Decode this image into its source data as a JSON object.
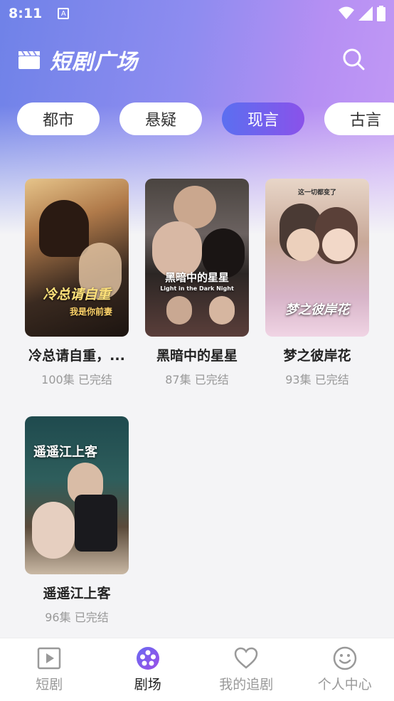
{
  "status": {
    "time": "8:11"
  },
  "header": {
    "title": "短剧广场"
  },
  "tabs": [
    {
      "label": "都市"
    },
    {
      "label": "悬疑"
    },
    {
      "label": "现言"
    },
    {
      "label": "古言"
    }
  ],
  "dramas": [
    {
      "title": "冷总请自重，...",
      "episodes": "100集",
      "status": "已完结",
      "poster_text": "冷总请自重",
      "poster_sub": "我是你前妻"
    },
    {
      "title": "黑暗中的星星",
      "episodes": "87集",
      "status": "已完结",
      "poster_text": "黑暗中的星星",
      "poster_sub": "Light in the Dark Night"
    },
    {
      "title": "梦之彼岸花",
      "episodes": "93集",
      "status": "已完结",
      "poster_text": "梦之彼岸花",
      "poster_sub": "这一切都变了"
    },
    {
      "title": "遥遥江上客",
      "episodes": "96集",
      "status": "已完结",
      "poster_text": "遥遥江上客",
      "poster_sub": ""
    }
  ],
  "nav": [
    {
      "label": "短剧",
      "icon": "play-square-icon"
    },
    {
      "label": "剧场",
      "icon": "film-reel-icon"
    },
    {
      "label": "我的追剧",
      "icon": "heart-icon"
    },
    {
      "label": "个人中心",
      "icon": "smiley-icon"
    }
  ],
  "colors": {
    "accent": "#6a5ff0",
    "active_tab_start": "#5b6ff0",
    "active_tab_end": "#8a52ea"
  }
}
